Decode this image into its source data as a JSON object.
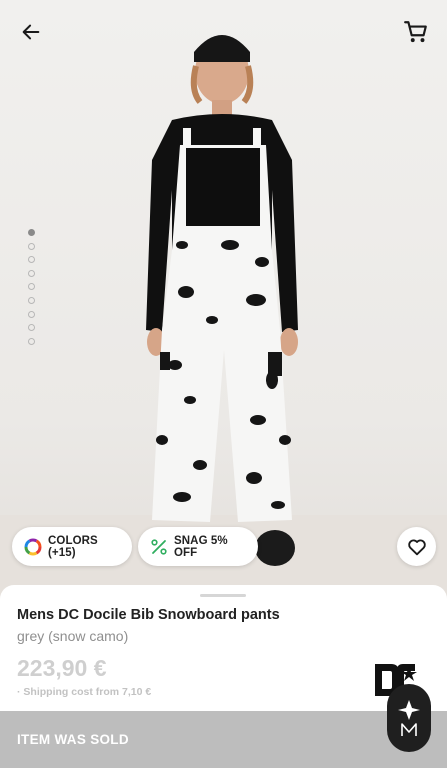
{
  "product": {
    "title": "Mens DC Docile Bib Snowboard pants",
    "color_name": "grey (snow camo)",
    "price": "223,90 €",
    "shipping": "· Shipping cost from 7,10 €"
  },
  "chips": {
    "colors_label": "COLORS (+15)",
    "snag_label": "SNAG 5% OFF"
  },
  "gallery": {
    "image_count": 9,
    "active_index": 0
  },
  "status": {
    "sold_label": "ITEM WAS SOLD"
  },
  "icons": [
    "arrow-left-icon",
    "cart-icon",
    "color-wheel-icon",
    "percent-icon",
    "heart-icon",
    "dc-brand-logo",
    "assistant-badge-icon"
  ],
  "colors": {
    "accent_green": "#2fae5f",
    "sold_bar": "#bdbdbd"
  }
}
